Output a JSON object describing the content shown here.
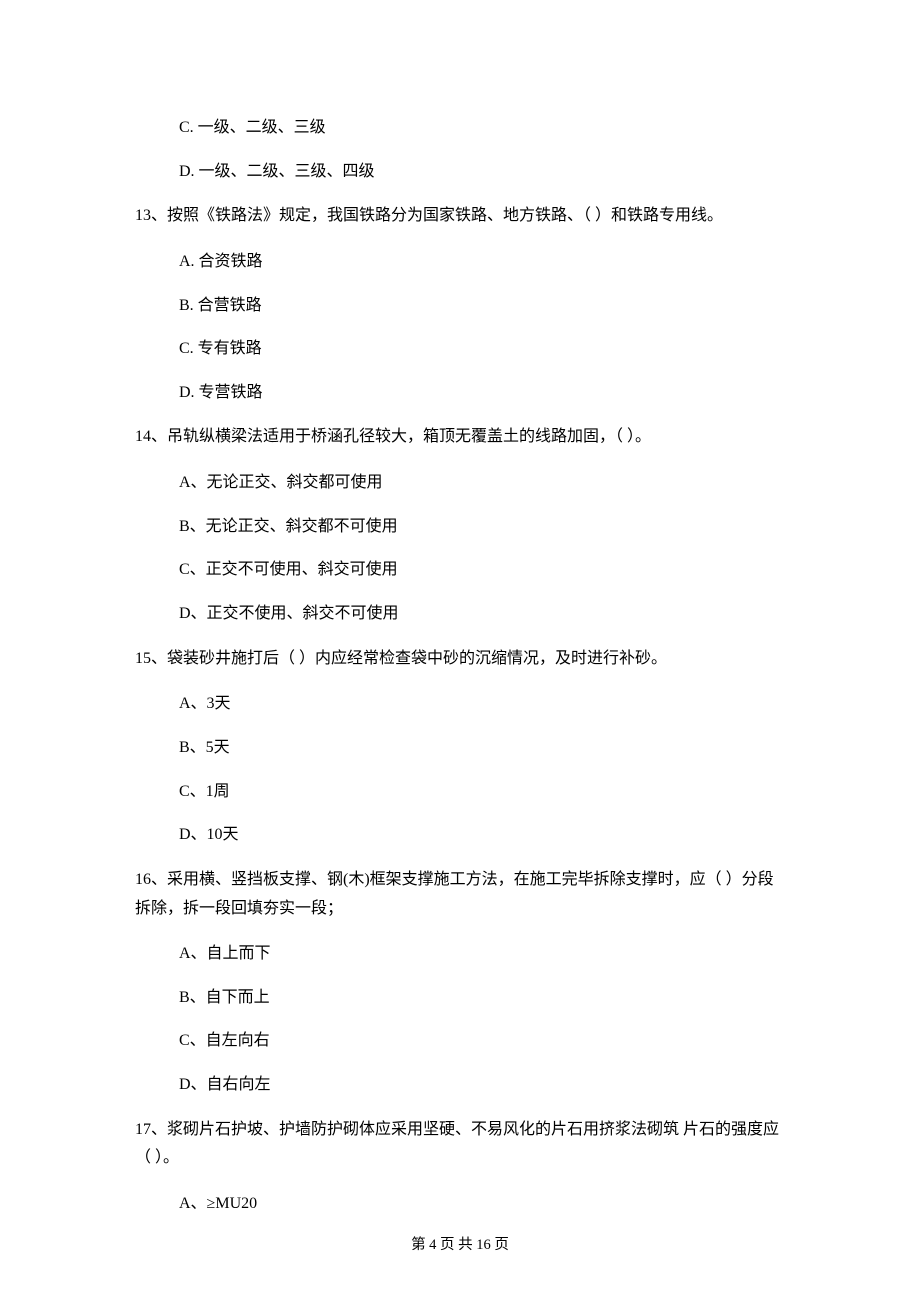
{
  "orphan_options": [
    "C.  一级、二级、三级",
    "D.  一级、二级、三级、四级"
  ],
  "questions": [
    {
      "stem": "13、按照《铁路法》规定，我国铁路分为国家铁路、地方铁路、（     ）和铁路专用线。",
      "options": [
        "A.  合资铁路",
        "B.  合营铁路",
        "C.  专有铁路",
        "D. 专营铁路"
      ]
    },
    {
      "stem": "14、吊轨纵横梁法适用于桥涵孔径较大，箱顶无覆盖土的线路加固，（     ）。",
      "options": [
        "A、无论正交、斜交都可使用",
        "B、无论正交、斜交都不可使用",
        "C、正交不可使用、斜交可使用",
        "D、正交不使用、斜交不可使用"
      ]
    },
    {
      "stem": "15、袋装砂井施打后（     ）内应经常检查袋中砂的沉缩情况，及时进行补砂。",
      "options": [
        "A、3天",
        "B、5天",
        "C、1周",
        "D、10天"
      ]
    },
    {
      "stem": "16、采用横、竖挡板支撑、钢(木)框架支撑施工方法，在施工完毕拆除支撑时，应（     ）分段拆除，拆一段回填夯实一段；",
      "options": [
        "A、自上而下",
        "B、自下而上",
        "C、自左向右",
        "D、自右向左"
      ]
    },
    {
      "stem": "17、浆砌片石护坡、护墙防护砌体应采用坚硬、不易风化的片石用挤浆法砌筑 片石的强度应（     ）。",
      "options": [
        "A、≥MU20"
      ]
    }
  ],
  "pager": "第 4 页 共 16 页"
}
